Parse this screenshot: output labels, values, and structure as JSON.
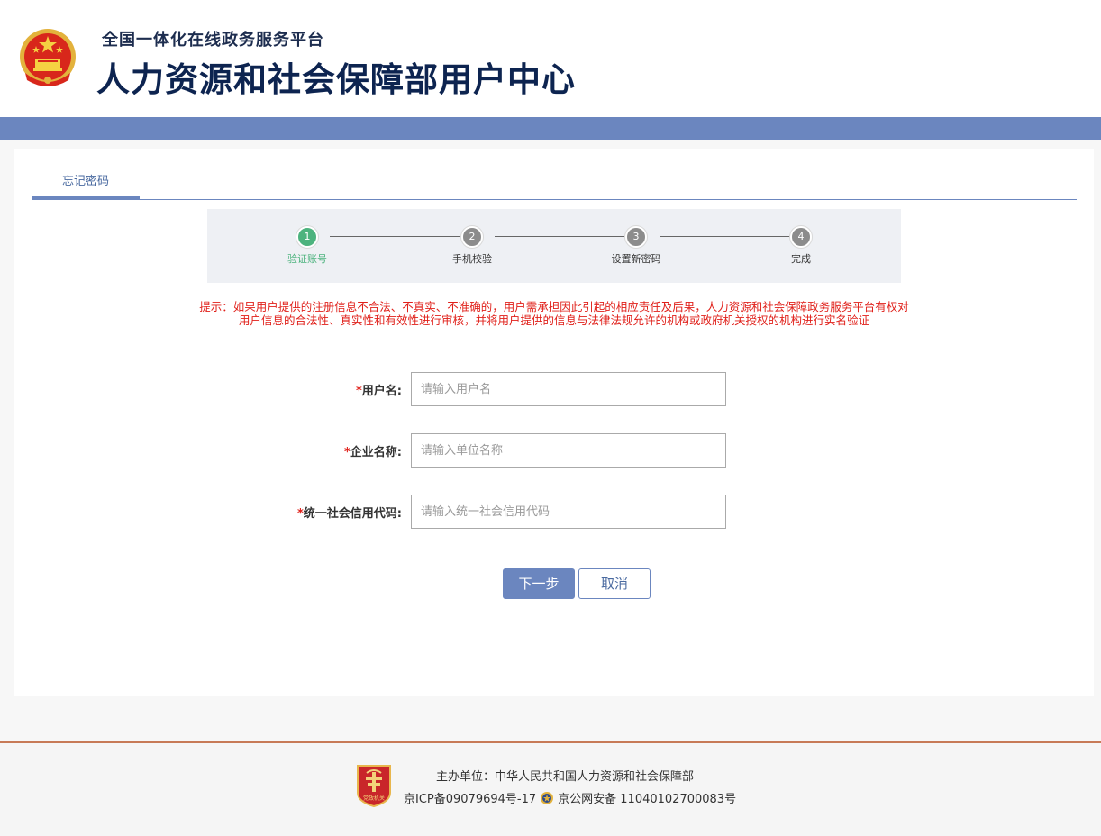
{
  "header": {
    "subtitle": "全国一体化在线政务服务平台",
    "title": "人力资源和社会保障部用户中心"
  },
  "tabs": [
    {
      "label": "忘记密码"
    }
  ],
  "steps": [
    {
      "number": "1",
      "label": "验证账号",
      "state": "active"
    },
    {
      "number": "2",
      "label": "手机校验",
      "state": "pending"
    },
    {
      "number": "3",
      "label": "设置新密码",
      "state": "pending"
    },
    {
      "number": "4",
      "label": "完成",
      "state": "pending"
    }
  ],
  "notice": "提示：如果用户提供的注册信息不合法、不真实、不准确的，用户需承担因此引起的相应责任及后果，人力资源和社会保障政务服务平台有权对用户信息的合法性、真实性和有效性进行审核，并将用户提供的信息与法律法规允许的机构或政府机关授权的机构进行实名验证",
  "form": {
    "fields": [
      {
        "required_mark": "*",
        "label": "用户名:",
        "value": "",
        "placeholder": "请输入用户名"
      },
      {
        "required_mark": "*",
        "label": "企业名称:",
        "value": "",
        "placeholder": "请输入单位名称"
      },
      {
        "required_mark": "*",
        "label": "统一社会信用代码:",
        "value": "",
        "placeholder": "请输入统一社会信用代码"
      }
    ],
    "next_label": "下一步",
    "cancel_label": "取消"
  },
  "footer": {
    "badge_text": "党政机关",
    "sponsor": "主办单位：中华人民共和国人力资源和社会保障部",
    "icp": "京ICP备09079694号-17",
    "police": "京公网安备 11040102700083号"
  },
  "colors": {
    "brand_blue": "#6b86bf",
    "title_navy": "#0d2450",
    "active_green": "#4db37e",
    "warning_red": "#e0201a",
    "footer_border": "#c77a57"
  },
  "icons": {
    "emblem": "national-emblem-icon",
    "footer_badge": "party-government-badge-icon",
    "police": "police-badge-icon"
  }
}
